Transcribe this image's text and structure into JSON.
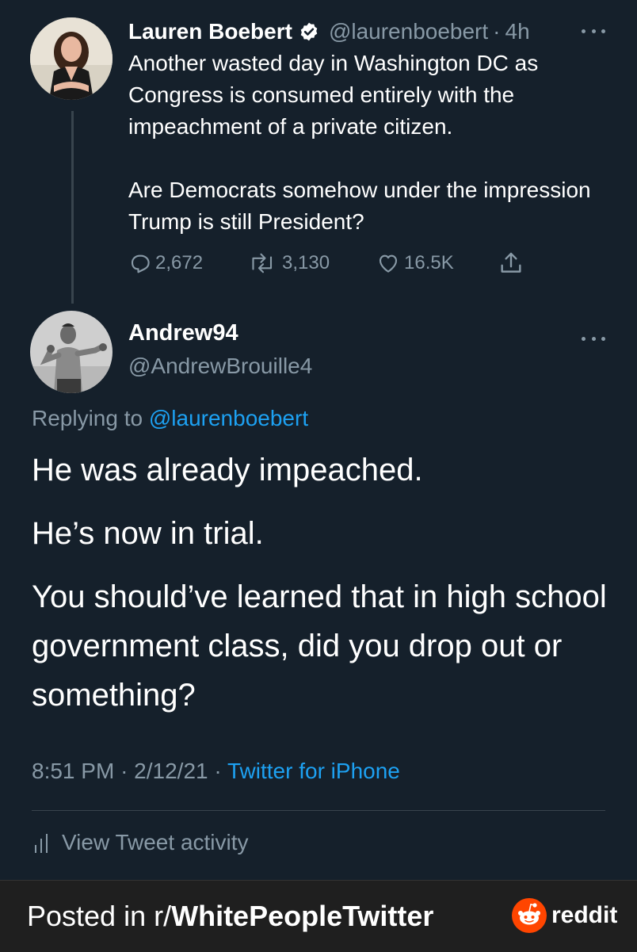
{
  "original_tweet": {
    "author_name": "Lauren Boebert",
    "handle": "@laurenboebert",
    "separator": "·",
    "time": "4h",
    "paragraphs": [
      "Another wasted day in Washington DC as Congress is consumed entirely with the impeachment of a private citizen.",
      "Are Democrats somehow under the impression Trump is still President?"
    ],
    "stats": {
      "replies": "2,672",
      "retweets": "3,130",
      "likes": "16.5K"
    }
  },
  "reply_tweet": {
    "author_name": "Andrew94",
    "handle": "@AndrewBrouille4",
    "replying_prefix": "Replying to",
    "replying_handle": "@laurenboebert",
    "paragraphs": [
      "He was already impeached.",
      "He’s now in trial.",
      "You should’ve learned that in high school government class, did you drop out or something?"
    ],
    "time": "8:51 PM",
    "date": "2/12/21",
    "separator": "·",
    "client": "Twitter for iPhone",
    "activity_label": "View Tweet activity"
  },
  "footer": {
    "prefix": "Posted in r/",
    "subreddit": "WhitePeopleTwitter",
    "brand": "reddit"
  },
  "colors": {
    "background": "#15202b",
    "text": "#ffffff",
    "muted": "#8899a6",
    "link": "#1da1f2",
    "reddit_orange": "#ff4500"
  }
}
